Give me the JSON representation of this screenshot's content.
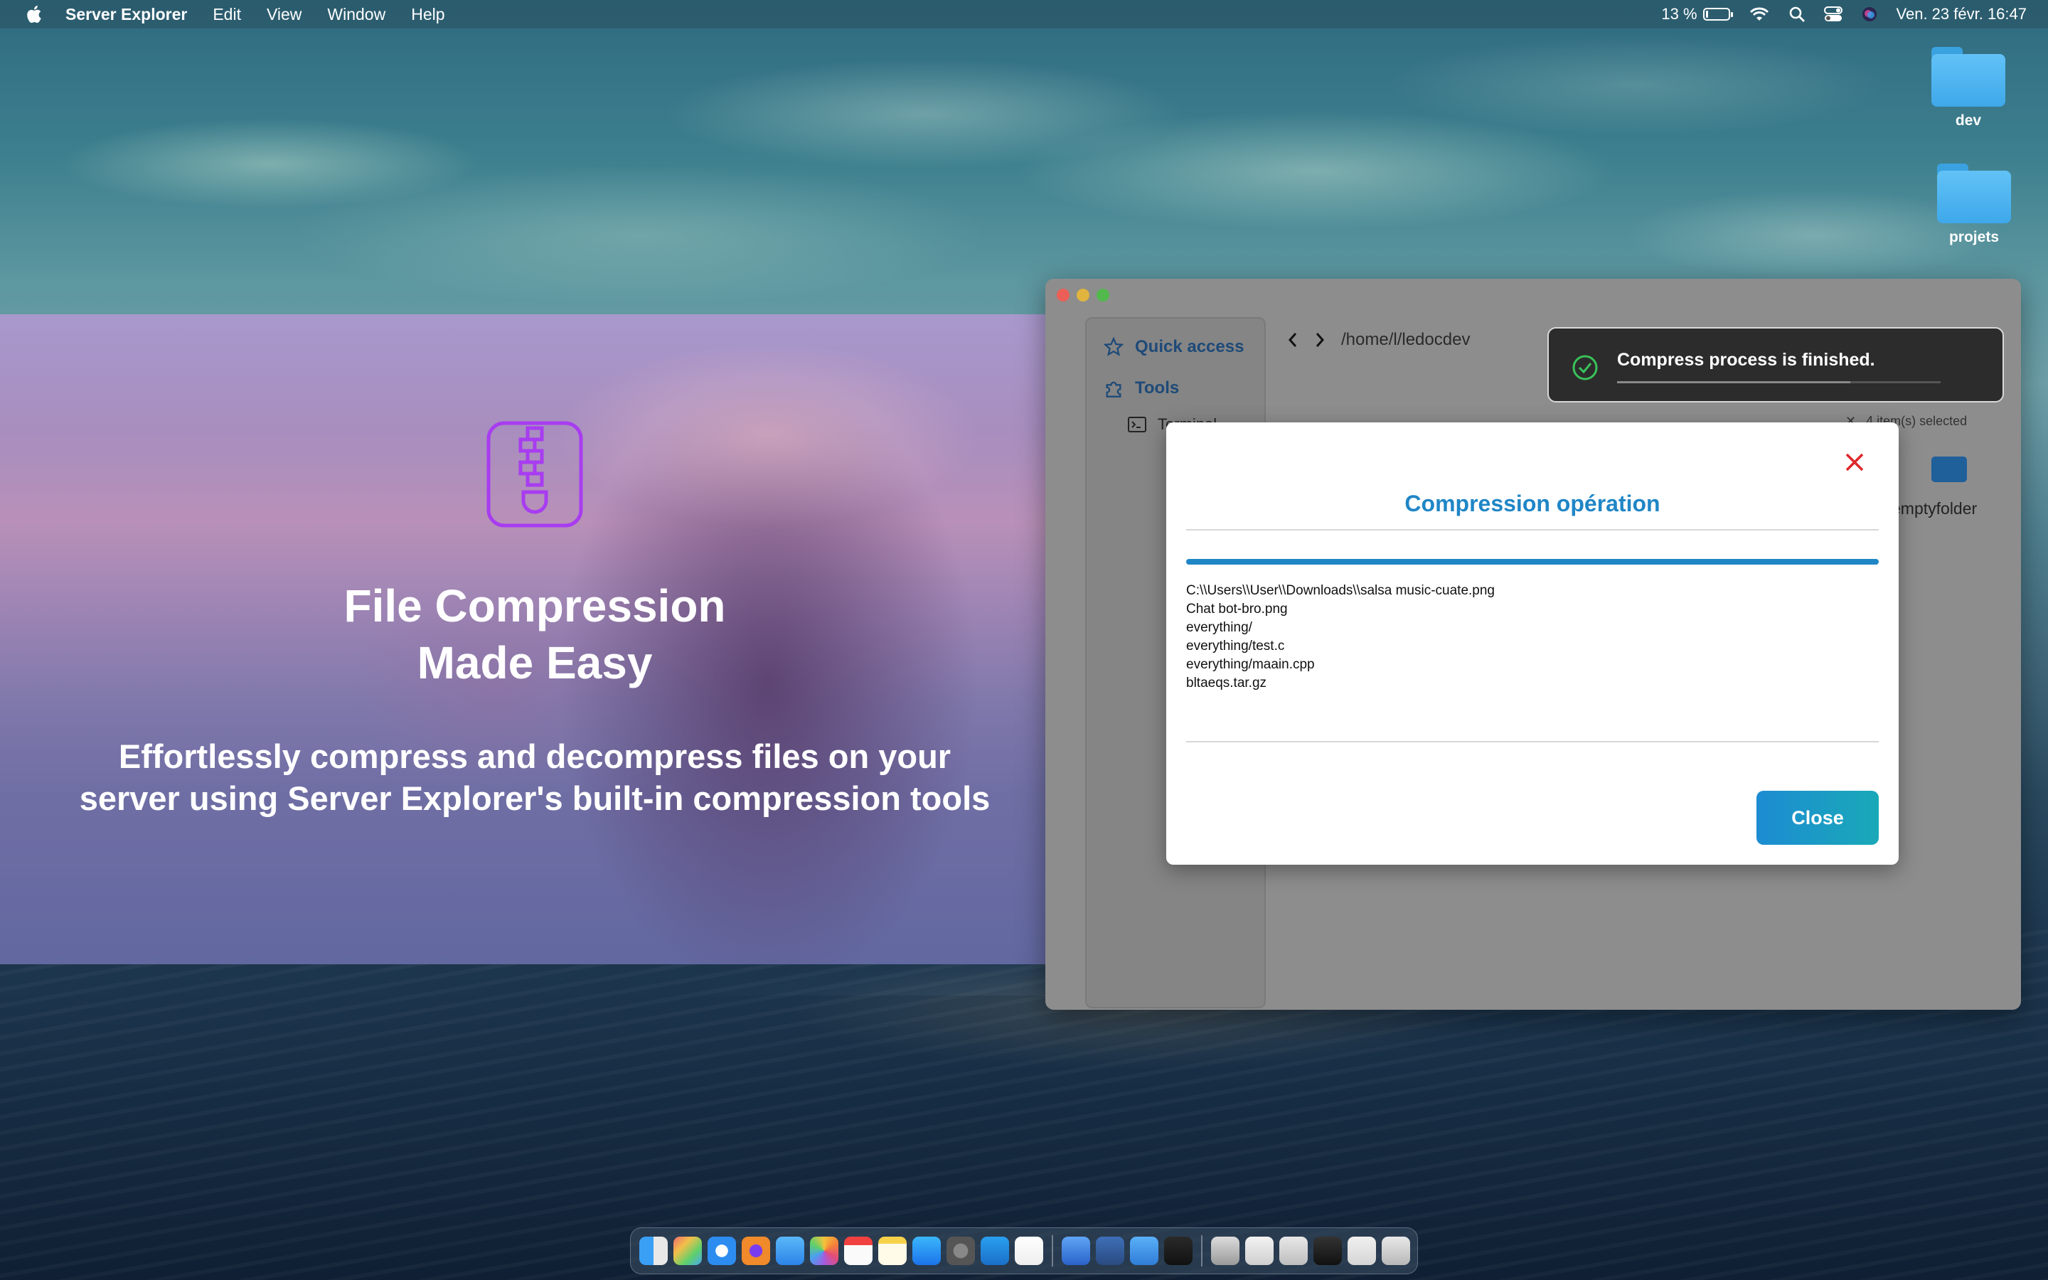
{
  "menubar": {
    "app_name": "Server Explorer",
    "items": [
      "Edit",
      "View",
      "Window",
      "Help"
    ],
    "battery_percent": "13 %",
    "battery_level": 0.13,
    "datetime": "Ven. 23 févr.  16:47"
  },
  "desktop": {
    "folders": [
      {
        "label": "dev"
      },
      {
        "label": "projets"
      }
    ]
  },
  "promo": {
    "title_line1": "File Compression",
    "title_line2": "Made Easy",
    "subtitle": "Effortlessly compress and decompress files on your server using Server Explorer's built-in compression tools",
    "icon": "zip-file-icon",
    "accent_color": "#a83cf0"
  },
  "window": {
    "sidebar": {
      "quick_access": "Quick access",
      "tools": "Tools",
      "terminal": "Terminal"
    },
    "path": "/home/l/ledocdev",
    "selection_info": "4 item(s) selected",
    "folder_label": "emptyfolder"
  },
  "toast": {
    "message": "Compress process is finished.",
    "progress": 0.72,
    "status_color": "#39c25a"
  },
  "modal": {
    "title": "Compression opération",
    "progress": 1.0,
    "files": [
      "C:\\\\Users\\\\User\\\\Downloads\\\\salsa music-cuate.png",
      "Chat bot-bro.png",
      "everything/",
      "everything/test.c",
      "everything/maain.cpp",
      "bltaeqs.tar.gz"
    ],
    "close_button": "Close",
    "accent_color": "#1f86c6"
  },
  "dock": {
    "apps": [
      "finder",
      "launchpad",
      "safari",
      "firefox",
      "mail",
      "photos",
      "calendar",
      "notes",
      "app-store",
      "system-settings",
      "vscode",
      "notion",
      "xcode",
      "server-explorer",
      "preview",
      "terminal",
      "finder-window",
      "window-1",
      "window-2",
      "window-3",
      "window-4",
      "trash"
    ]
  }
}
